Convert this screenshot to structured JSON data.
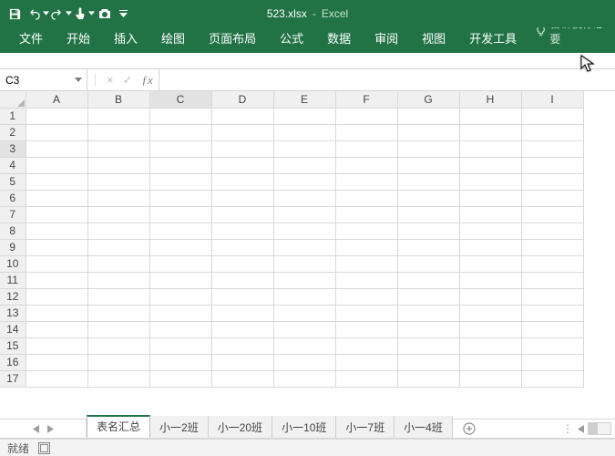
{
  "titlebar": {
    "filename": "523.xlsx",
    "app_name": "Excel",
    "qat_icons": [
      "save-icon",
      "undo-icon",
      "redo-icon",
      "touch-icon",
      "camera-icon",
      "customize-qat-icon"
    ]
  },
  "ribbon": {
    "tabs": [
      "文件",
      "开始",
      "插入",
      "绘图",
      "页面布局",
      "公式",
      "数据",
      "审阅",
      "视图",
      "开发工具"
    ],
    "tell_me": "告诉我你想要"
  },
  "namebox": {
    "value": "C3"
  },
  "formula_bar": {
    "value": ""
  },
  "grid": {
    "columns": [
      "A",
      "B",
      "C",
      "D",
      "E",
      "F",
      "G",
      "H",
      "I"
    ],
    "rows": [
      "1",
      "2",
      "3",
      "4",
      "5",
      "6",
      "7",
      "8",
      "9",
      "10",
      "11",
      "12",
      "13",
      "14",
      "15",
      "16",
      "17"
    ],
    "active_row": "3",
    "active_col": "C"
  },
  "sheets": {
    "tabs": [
      {
        "label": "表名汇总",
        "active": true
      },
      {
        "label": "小一2班",
        "active": false
      },
      {
        "label": "小一20班",
        "active": false
      },
      {
        "label": "小一10班",
        "active": false
      },
      {
        "label": "小一7班",
        "active": false
      },
      {
        "label": "小一4班",
        "active": false
      }
    ]
  },
  "status_bar": {
    "status": "就绪"
  },
  "colors": {
    "brand": "#217346"
  }
}
